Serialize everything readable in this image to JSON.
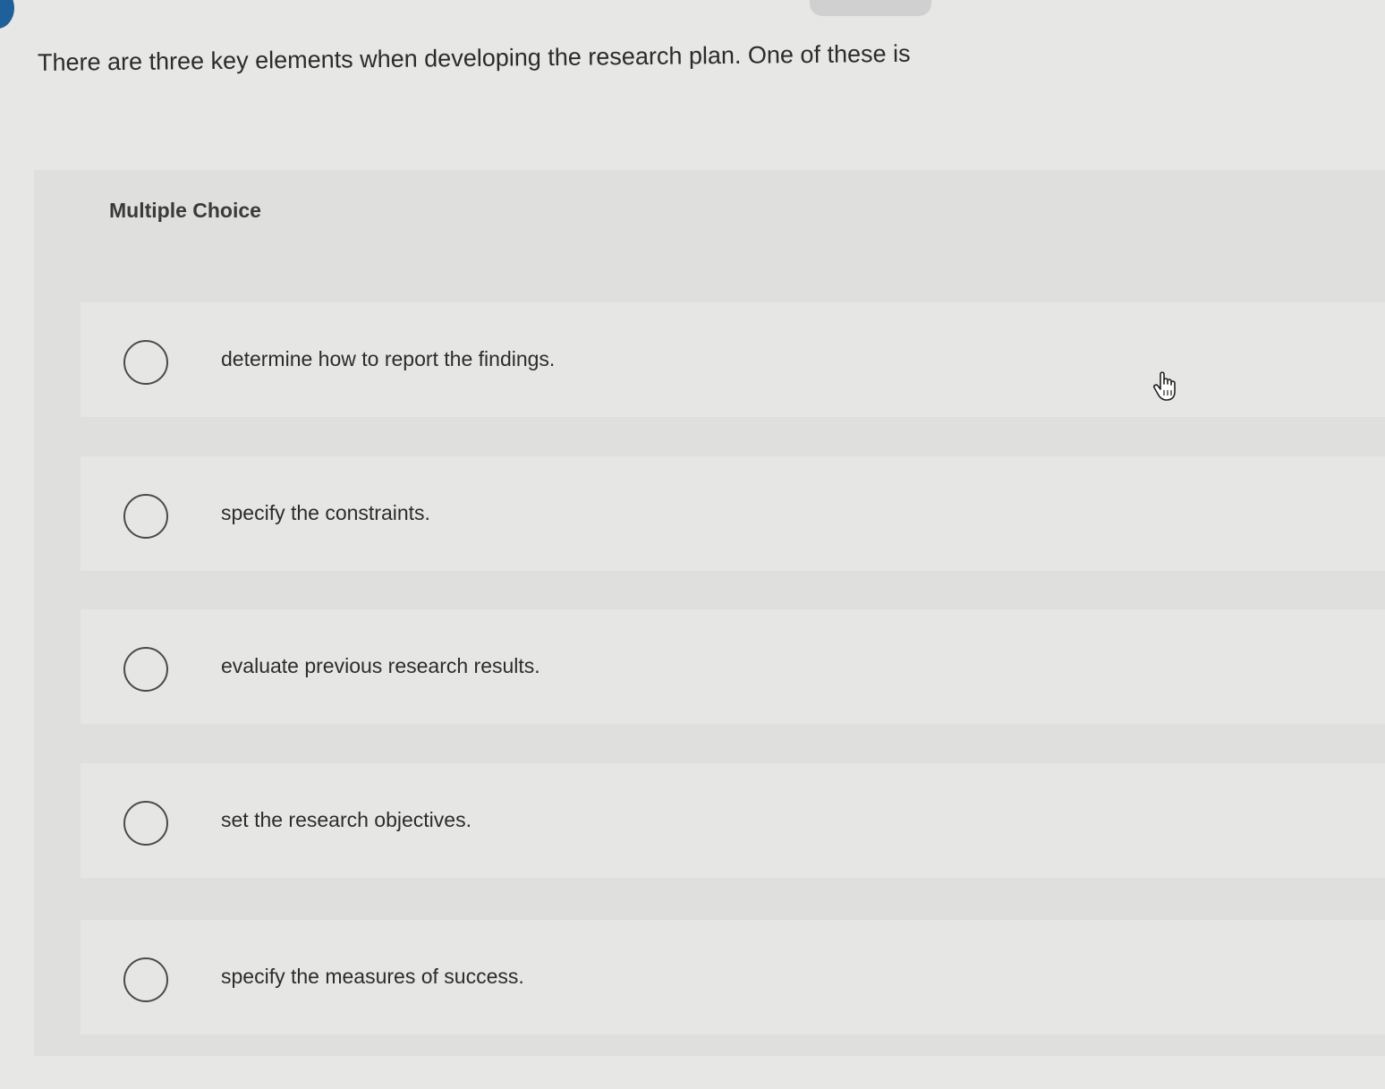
{
  "question": {
    "text": "There are three key elements when developing the research plan. One of these is"
  },
  "multiple_choice": {
    "label": "Multiple Choice",
    "options": [
      {
        "text": "determine how to report the findings."
      },
      {
        "text": "specify the constraints."
      },
      {
        "text": "evaluate previous research results."
      },
      {
        "text": "set the research objectives."
      },
      {
        "text": "specify the measures of success."
      }
    ]
  },
  "colors": {
    "page_background": "#e7e7e5",
    "panel_background": "#dfdfdd",
    "option_background": "#e6e6e4",
    "text": "#2c2c2c",
    "radio_border": "#4a4a4a",
    "corner_accent": "#1f5f9a"
  },
  "icons": {
    "pointer": "hand-pointer-icon"
  }
}
